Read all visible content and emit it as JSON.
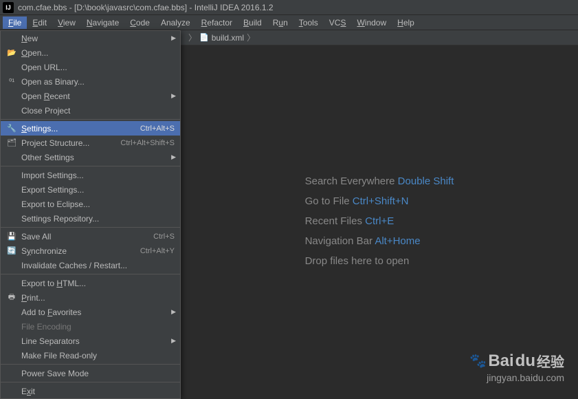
{
  "title": "com.cfae.bbs - [D:\\book\\javasrc\\com.cfae.bbs] - IntelliJ IDEA 2016.1.2",
  "menubar": [
    {
      "label": "File",
      "u": "F"
    },
    {
      "label": "Edit",
      "u": "E"
    },
    {
      "label": "View",
      "u": "V"
    },
    {
      "label": "Navigate",
      "u": "N"
    },
    {
      "label": "Code",
      "u": "C"
    },
    {
      "label": "Analyze"
    },
    {
      "label": "Refactor",
      "u": "R"
    },
    {
      "label": "Build",
      "u": "B"
    },
    {
      "label": "Run",
      "u": "u"
    },
    {
      "label": "Tools",
      "u": "T"
    },
    {
      "label": "VCS",
      "u": "S"
    },
    {
      "label": "Window",
      "u": "W"
    },
    {
      "label": "Help",
      "u": "H"
    }
  ],
  "breadcrumb": {
    "file": "build.xml"
  },
  "fileMenu": [
    {
      "type": "item",
      "label": "New",
      "u": "N",
      "arrow": true
    },
    {
      "type": "item",
      "label": "Open...",
      "u": "O",
      "icon": "folder"
    },
    {
      "type": "item",
      "label": "Open URL..."
    },
    {
      "type": "item",
      "label": "Open as Binary...",
      "icon": "binary"
    },
    {
      "type": "item",
      "label": "Open Recent",
      "u": "R",
      "arrow": true
    },
    {
      "type": "item",
      "label": "Close Project"
    },
    {
      "type": "sep"
    },
    {
      "type": "item",
      "label": "Settings...",
      "u": "S",
      "shortcut": "Ctrl+Alt+S",
      "icon": "wrench",
      "selected": true
    },
    {
      "type": "item",
      "label": "Project Structure...",
      "shortcut": "Ctrl+Alt+Shift+S",
      "icon": "structure"
    },
    {
      "type": "item",
      "label": "Other Settings",
      "arrow": true
    },
    {
      "type": "sep"
    },
    {
      "type": "item",
      "label": "Import Settings..."
    },
    {
      "type": "item",
      "label": "Export Settings..."
    },
    {
      "type": "item",
      "label": "Export to Eclipse..."
    },
    {
      "type": "item",
      "label": "Settings Repository..."
    },
    {
      "type": "sep"
    },
    {
      "type": "item",
      "label": "Save All",
      "shortcut": "Ctrl+S",
      "icon": "save"
    },
    {
      "type": "item",
      "label": "Synchronize",
      "u": "y",
      "shortcut": "Ctrl+Alt+Y",
      "icon": "sync"
    },
    {
      "type": "item",
      "label": "Invalidate Caches / Restart..."
    },
    {
      "type": "sep"
    },
    {
      "type": "item",
      "label": "Export to HTML...",
      "u": "H"
    },
    {
      "type": "item",
      "label": "Print...",
      "u": "P",
      "icon": "print"
    },
    {
      "type": "item",
      "label": "Add to Favorites",
      "u": "F",
      "arrow": true
    },
    {
      "type": "item",
      "label": "File Encoding",
      "disabled": true
    },
    {
      "type": "item",
      "label": "Line Separators",
      "arrow": true
    },
    {
      "type": "item",
      "label": "Make File Read-only"
    },
    {
      "type": "sep"
    },
    {
      "type": "item",
      "label": "Power Save Mode"
    },
    {
      "type": "sep"
    },
    {
      "type": "item",
      "label": "Exit",
      "u": "x"
    }
  ],
  "hints": [
    {
      "text": "Search Everywhere",
      "key": "Double Shift"
    },
    {
      "text": "Go to File",
      "key": "Ctrl+Shift+N"
    },
    {
      "text": "Recent Files",
      "key": "Ctrl+E"
    },
    {
      "text": "Navigation Bar",
      "key": "Alt+Home"
    },
    {
      "text": "Drop files here to open",
      "key": ""
    }
  ],
  "watermark": {
    "brand": "Bai",
    "du": "du",
    "cn": "经验",
    "url": "jingyan.baidu.com"
  }
}
